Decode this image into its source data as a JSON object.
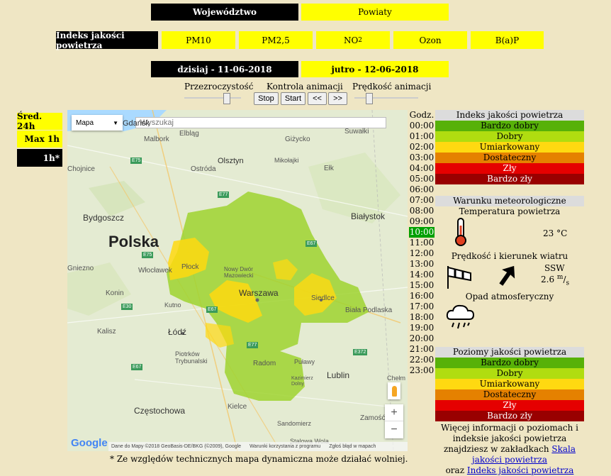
{
  "top_nav": {
    "wojewodztwo": "Województwo",
    "powiaty": "Powiaty"
  },
  "index_row": {
    "label": "Indeks jakości powietrza",
    "pm10": "PM10",
    "pm25": "PM2,5",
    "no2_base": "NO",
    "no2_sub": "2",
    "ozon": "Ozon",
    "bap": "B(a)P"
  },
  "days": {
    "today": "dzisiaj - 11-06-2018",
    "tomorrow": "jutro - 12-06-2018"
  },
  "controls": {
    "transparency": "Przezroczystość",
    "animation_control": "Kontrola animacji",
    "animation_speed": "Prędkość animacji",
    "stop": "Stop",
    "start": "Start",
    "prev": "<<",
    "next": ">>"
  },
  "left_menu": {
    "avg24": "Śred. 24h",
    "max1": "Max 1h",
    "h1": "1h*"
  },
  "map": {
    "type_select": "Mapa",
    "search_placeholder": "Wyszukaj",
    "labels": {
      "gdansk": "Gdańsk",
      "olsztyn": "Olsztyn",
      "gizycko": "Giżycko",
      "suwalki": "Suwałki",
      "malbork": "Malbork",
      "elblag": "Elbląg",
      "chojnice": "Chojnice",
      "ostroda": "Ostróda",
      "mikolajki": "Mikołajki",
      "elk": "Ełk",
      "bydgoszcz": "Bydgoszcz",
      "bialystok": "Białystok",
      "polska": "Polska",
      "plock": "Płock",
      "wloclawek": "Włocławek",
      "gniezno": "Gniezno",
      "nowy_dwor": "Nowy Dwór Mazowiecki",
      "warszawa": "Warszawa",
      "siedlce": "Siedlce",
      "konin": "Konin",
      "kutno": "Kutno",
      "biala": "Biała Podlaska",
      "kalisz": "Kalisz",
      "lodz": "Łódź",
      "piotrkow": "Piotrków Trybunalski",
      "radom": "Radom",
      "pulawy": "Puławy",
      "lublin": "Lublin",
      "chelm": "Chełm",
      "kazimierz": "Kazimierz Dolny",
      "czestochowa": "Częstochowa",
      "kielce": "Kielce",
      "zamosc": "Zamość",
      "sandomierz": "Sandomierz",
      "stalowa": "Stalowa Wola"
    },
    "roads": {
      "e75a": "E75",
      "e77a": "E77",
      "e75b": "E75",
      "e67a": "E67",
      "e30": "E30",
      "e67b": "E67",
      "e77b": "E77",
      "e67c": "E67",
      "e372": "E372"
    },
    "zoom_in": "+",
    "zoom_out": "−",
    "google": "Google",
    "attribution": "Dane do Mapy ©2018 GeoBasis-DE/BKG (©2009), Google",
    "terms": "Warunki korzystania z programu",
    "report": "Zgłoś błąd w mapach",
    "note": "* Ze względów technicznych mapa dynamiczna może działać wolniej."
  },
  "hours": {
    "header": "Godz.",
    "list": [
      "00:00",
      "01:00",
      "02:00",
      "03:00",
      "04:00",
      "05:00",
      "06:00",
      "07:00",
      "08:00",
      "09:00",
      "10:00",
      "11:00",
      "12:00",
      "13:00",
      "14:00",
      "15:00",
      "16:00",
      "17:00",
      "18:00",
      "19:00",
      "20:00",
      "21:00",
      "22:00",
      "23:00"
    ],
    "active": "10:00"
  },
  "aq_index": {
    "title": "Indeks jakości powietrza",
    "levels": [
      {
        "label": "Bardzo dobry",
        "color": "#57b108",
        "text": "#000"
      },
      {
        "label": "Dobry",
        "color": "#b0dd10",
        "text": "#000"
      },
      {
        "label": "Umiarkowany",
        "color": "#ffd911",
        "text": "#000"
      },
      {
        "label": "Dostateczny",
        "color": "#e58100",
        "text": "#000"
      },
      {
        "label": "Zły",
        "color": "#e50000",
        "text": "#fff"
      },
      {
        "label": "Bardzo zły",
        "color": "#990000",
        "text": "#fff"
      }
    ]
  },
  "weather": {
    "title": "Warunku meteorologiczne",
    "temp_title": "Temperatura powietrza",
    "temp_value": "23",
    "temp_unit": "°C",
    "wind_title": "Prędkość i kierunek wiatru",
    "wind_dir": "SSW",
    "wind_speed": "2.6",
    "wind_unit_num": "m",
    "wind_unit_den": "s",
    "rain_title": "Opad atmosferyczny"
  },
  "aq_levels": {
    "title": "Poziomy jakości powietrza",
    "levels": [
      {
        "label": "Bardzo dobry",
        "color": "#57b108",
        "text": "#000"
      },
      {
        "label": "Dobry",
        "color": "#b0dd10",
        "text": "#000"
      },
      {
        "label": "Umiarkowany",
        "color": "#ffd911",
        "text": "#000"
      },
      {
        "label": "Dostateczny",
        "color": "#e58100",
        "text": "#000"
      },
      {
        "label": "Zły",
        "color": "#e50000",
        "text": "#fff"
      },
      {
        "label": "Bardzo zły",
        "color": "#990000",
        "text": "#fff"
      }
    ],
    "info_1": "Więcej informacji o poziomach i indeksie jakości powietrza znajdziesz w zakładkach",
    "link_1": "Skala jakości powietrza",
    "info_2": "oraz",
    "link_2": "Indeks jakości powietrza"
  }
}
